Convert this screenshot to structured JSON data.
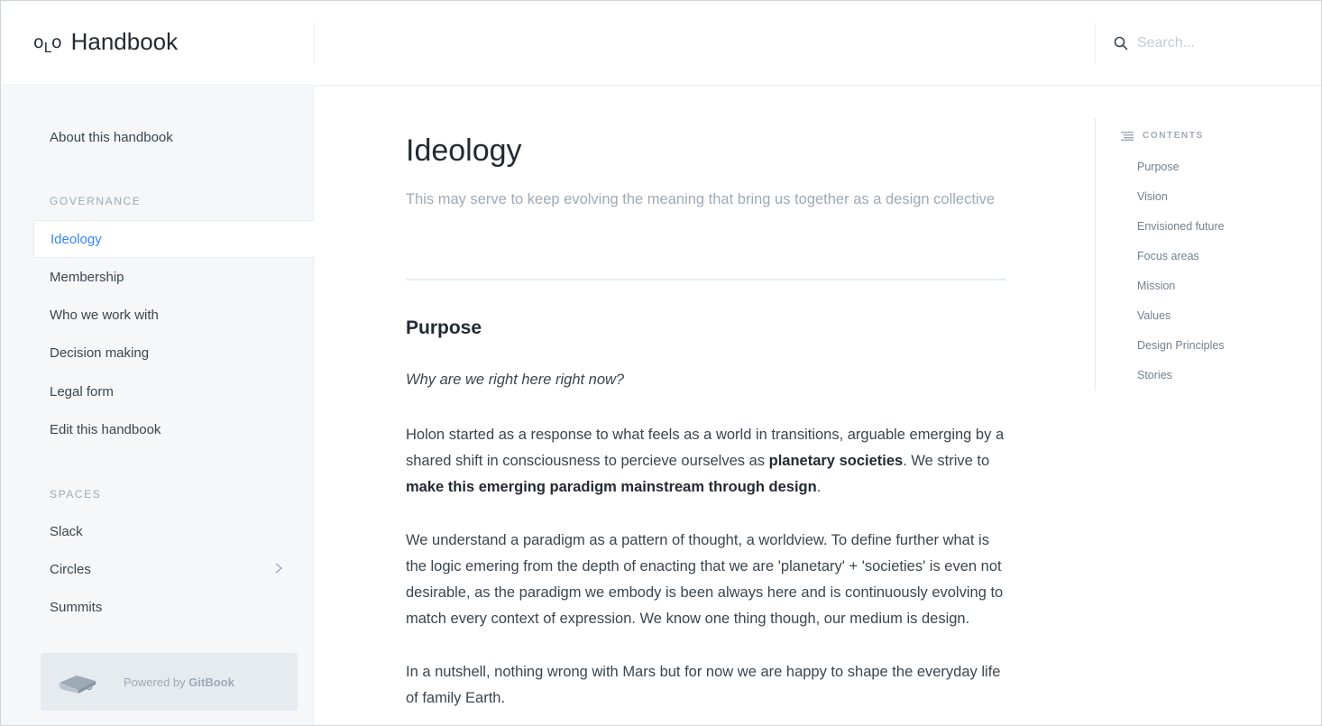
{
  "header": {
    "logo_text": "OLO",
    "title": "Handbook",
    "search_placeholder": "Search..."
  },
  "sidebar": {
    "top_item": "About this handbook",
    "sections": [
      {
        "heading": "GOVERNANCE",
        "items": [
          "Ideology",
          "Membership",
          "Who we work with",
          "Decision making",
          "Legal form",
          "Edit this handbook"
        ]
      },
      {
        "heading": "SPACES",
        "items": [
          "Slack",
          "Circles",
          "Summits"
        ]
      }
    ],
    "active_item": "Ideology",
    "expandable_item": "Circles",
    "powered_prefix": "Powered by ",
    "powered_brand": "GitBook"
  },
  "main": {
    "title": "Ideology",
    "description": "This may serve to keep evolving the meaning that bring us together as a design collective",
    "section_title": "Purpose",
    "question": "Why are we right here right now?",
    "p1": {
      "a": "Holon started as a response to what feels as a world in transitions, arguable emerging by a shared shift in consciousness to percieve ourselves as ",
      "b": "planetary societies",
      "c": ". We strive to ",
      "d": "make this emerging paradigm mainstream through design",
      "e": "."
    },
    "p2": "We understand a paradigm as a pattern of thought, a worldview. To define further what is the logic emering from the depth of enacting that we are 'planetary' + 'societies' is even not desirable, as the paradigm we embody is been always here and is continuously evolving to match every context of expression. We know one thing though, our medium is design.",
    "p3": "In a nutshell, nothing wrong with Mars but for now we are happy to shape the everyday life of family Earth."
  },
  "toc": {
    "heading": "CONTENTS",
    "items": [
      "Purpose",
      "Vision",
      "Envisioned future",
      "Focus areas",
      "Mission",
      "Values",
      "Design Principles",
      "Stories"
    ]
  },
  "colors": {
    "accent": "#3884ff",
    "sidebar_bg": "#f5f7f9",
    "muted": "#9daab6",
    "text": "#242a31"
  }
}
